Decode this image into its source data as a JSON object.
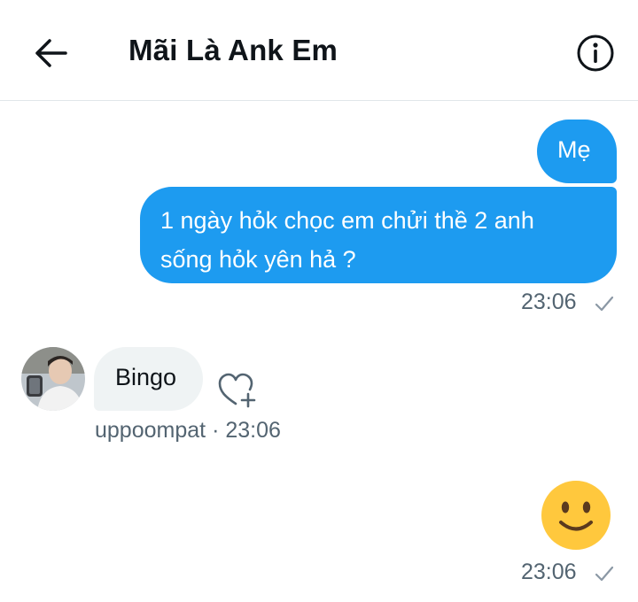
{
  "header": {
    "title": "Mãi Là Ank Em",
    "back_icon": "arrow-left-icon",
    "info_icon": "info-circle-icon"
  },
  "messages": {
    "outgoing_1": {
      "text": "Mẹ"
    },
    "outgoing_2": {
      "lines": [
        "1 ngày hỏk chọc em chửi thề 2 anh",
        "sống hỏk yên hả ?"
      ]
    },
    "outgoing_time": "23:06",
    "incoming": {
      "text": "Bingo",
      "username": "uppoompat",
      "separator": "·",
      "time": "23:06"
    },
    "emoji": {
      "icon": "slightly-smiling-face-icon",
      "time": "23:06"
    }
  },
  "colors": {
    "accent": "#1d9bf0",
    "incoming_bubble": "#eff3f4",
    "muted_text": "#536471",
    "emoji_face": "#ffc83d"
  }
}
